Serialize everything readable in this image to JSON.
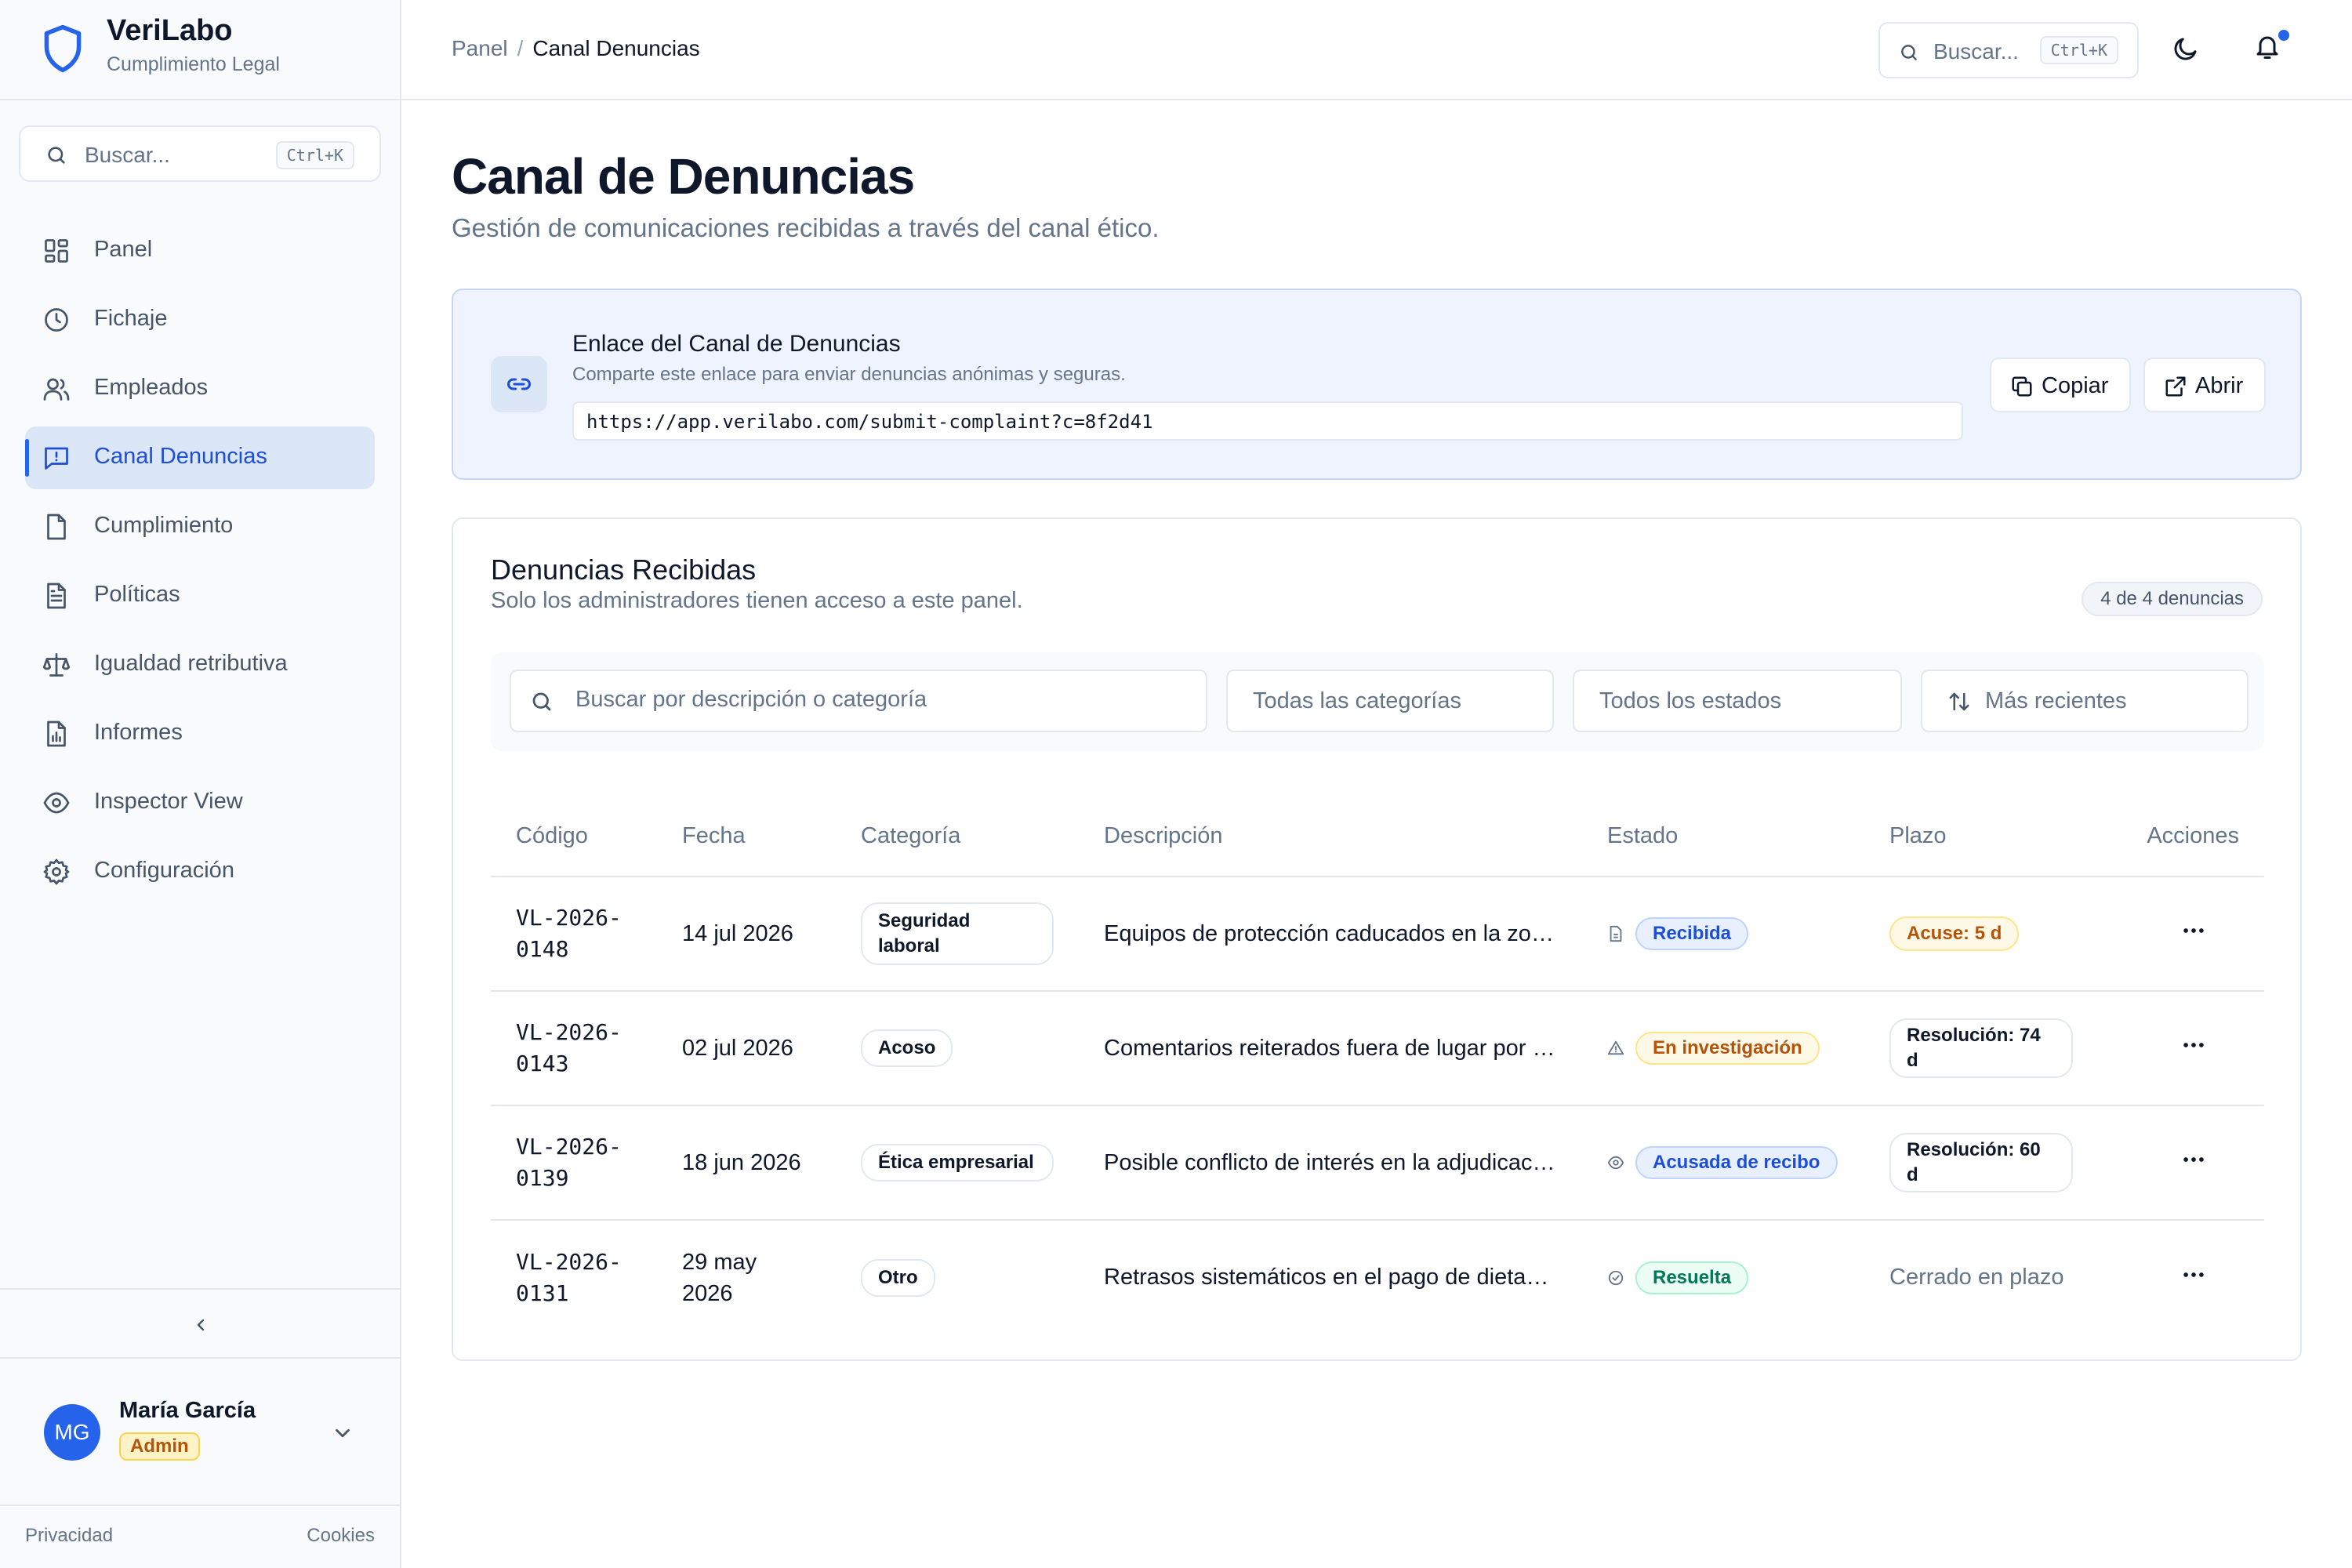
{
  "brand": {
    "name": "VeriLabo",
    "subtitle": "Cumplimiento Legal"
  },
  "sidebar": {
    "search": {
      "placeholder": "Buscar...",
      "shortcut": "Ctrl+K"
    },
    "items": [
      {
        "label": "Panel",
        "icon": "dashboard-icon"
      },
      {
        "label": "Fichaje",
        "icon": "clock-icon"
      },
      {
        "label": "Empleados",
        "icon": "users-icon"
      },
      {
        "label": "Canal Denuncias",
        "icon": "message-alert-icon",
        "active": true
      },
      {
        "label": "Cumplimiento",
        "icon": "file-check-icon"
      },
      {
        "label": "Políticas",
        "icon": "file-text-icon"
      },
      {
        "label": "Igualdad retributiva",
        "icon": "scale-icon"
      },
      {
        "label": "Informes",
        "icon": "chart-file-icon"
      },
      {
        "label": "Inspector View",
        "icon": "eye-icon"
      },
      {
        "label": "Configuración",
        "icon": "gear-icon"
      }
    ],
    "user": {
      "initials": "MG",
      "name": "María García",
      "role": "Admin"
    },
    "footer": {
      "privacy": "Privacidad",
      "cookies": "Cookies"
    }
  },
  "topbar": {
    "breadcrumb": {
      "parent": "Panel",
      "separator": "/",
      "current": "Canal Denuncias"
    },
    "search": {
      "placeholder": "Buscar...",
      "shortcut": "Ctrl+K"
    }
  },
  "page": {
    "title": "Canal de Denuncias",
    "subtitle": "Gestión de comunicaciones recibidas a través del canal ético."
  },
  "link_card": {
    "title": "Enlace del Canal de Denuncias",
    "description": "Comparte este enlace para enviar denuncias anónimas y seguras.",
    "url": "https://app.verilabo.com/submit-complaint?c=8f2d41",
    "copy_label": "Copiar",
    "open_label": "Abrir"
  },
  "complaints": {
    "title": "Denuncias Recibidas",
    "subtitle": "Solo los administradores tienen acceso a este panel.",
    "count": "4 de 4 denuncias",
    "filters": {
      "search_placeholder": "Buscar por descripción o categoría",
      "category": "Todas las categorías",
      "status": "Todos los estados",
      "sort": "Más recientes"
    },
    "columns": {
      "code": "Código",
      "date": "Fecha",
      "category": "Categoría",
      "description": "Descripción",
      "status": "Estado",
      "deadline": "Plazo",
      "actions": "Acciones"
    },
    "rows": [
      {
        "code_line1": "VL-2026-",
        "code_line2": "0148",
        "date": "14 jul 2026",
        "category": "Seguridad laboral",
        "description": "Equipos de protección caducados en la zona de almacén",
        "status": "Recibida",
        "deadline": "Acuse: 5 d"
      },
      {
        "code_line1": "VL-2026-",
        "code_line2": "0143",
        "date": "02 jul 2026",
        "category": "Acoso",
        "description": "Comentarios reiterados fuera de lugar por parte de un superior",
        "status": "En investigación",
        "deadline": "Resolución: 74 d"
      },
      {
        "code_line1": "VL-2026-",
        "code_line2": "0139",
        "date": "18 jun 2026",
        "category": "Ética empresarial",
        "description": "Posible conflicto de interés en la adjudicación de contratos",
        "status": "Acusada de recibo",
        "deadline": "Resolución: 60 d"
      },
      {
        "code_line1": "VL-2026-",
        "code_line2": "0131",
        "date": "29 may 2026",
        "category": "Otro",
        "description": "Retrasos sistemáticos en el pago de dietas y desplazamientos",
        "status": "Resuelta",
        "deadline": "Cerrado en plazo"
      }
    ]
  },
  "colors": {
    "accent": "#2563eb",
    "active_bg": "#dbe6f7",
    "warning": "#b45309",
    "success": "#047857"
  }
}
